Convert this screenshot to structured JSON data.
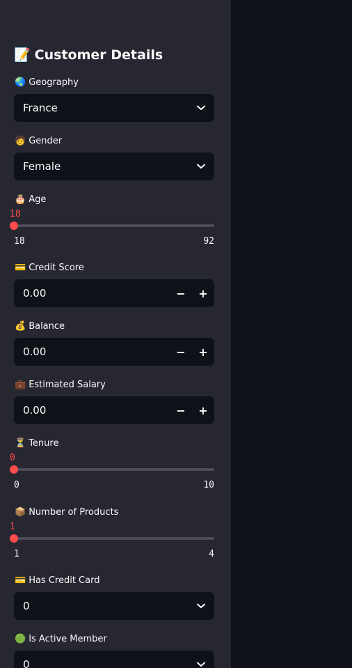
{
  "sidebar": {
    "title": "Customer Details",
    "title_emoji": "📝",
    "geography": {
      "emoji": "🌏",
      "label": "Geography",
      "value": "France"
    },
    "gender": {
      "emoji": "🧑",
      "label": "Gender",
      "value": "Female"
    },
    "age": {
      "emoji": "🎂",
      "label": "Age",
      "value": "18",
      "min": "18",
      "max": "92",
      "fraction": 0
    },
    "credit_score": {
      "emoji": "💳",
      "label": "Credit Score",
      "value": "0.00",
      "minus": "−",
      "plus": "+"
    },
    "balance": {
      "emoji": "💰",
      "label": "Balance",
      "value": "0.00",
      "minus": "−",
      "plus": "+"
    },
    "estimated_salary": {
      "emoji": "💼",
      "label": "Estimated Salary",
      "value": "0.00",
      "minus": "−",
      "plus": "+"
    },
    "tenure": {
      "emoji": "⏳",
      "label": "Tenure",
      "value": "0",
      "min": "0",
      "max": "10",
      "fraction": 0
    },
    "num_products": {
      "emoji": "📦",
      "label": "Number of Products",
      "value": "1",
      "min": "1",
      "max": "4",
      "fraction": 0
    },
    "has_credit_card": {
      "emoji": "💳",
      "label": "Has Credit Card",
      "value": "0"
    },
    "is_active_member": {
      "emoji": "🟢",
      "label": "Is Active Member",
      "value": "0"
    }
  },
  "colors": {
    "sidebar_bg": "#262730",
    "main_bg": "#0e1117",
    "input_bg": "#0e1117",
    "accent": "#ff4b4b",
    "text": "#fafafa"
  },
  "icons": {
    "dropdown": "chevron-down-icon",
    "minus": "minus-icon",
    "plus": "plus-icon"
  }
}
